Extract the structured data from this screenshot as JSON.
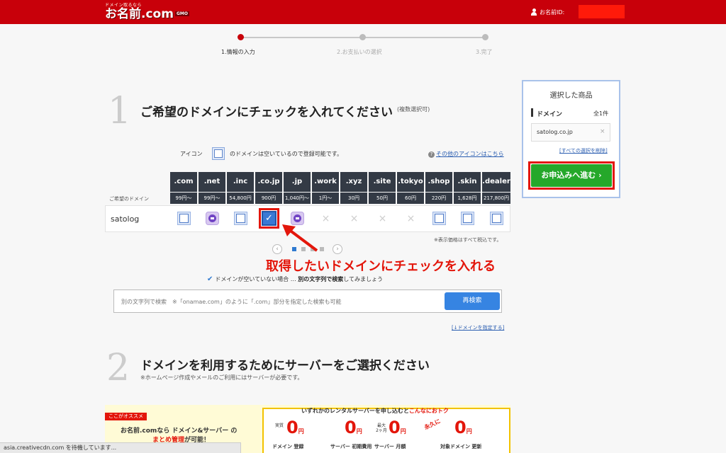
{
  "header": {
    "logo_top": "ドメイン取るなら",
    "logo_main": "お名前.com",
    "logo_badge": "GMO",
    "user_label": "お名前ID:"
  },
  "steps": [
    {
      "label": "1.情報の入力",
      "active": true
    },
    {
      "label": "2.お支払いの選択",
      "active": false
    },
    {
      "label": "3.完了",
      "active": false
    }
  ],
  "section1": {
    "number": "1",
    "title": "ご希望のドメインにチェックを入れてください",
    "note": "(複数選択可)"
  },
  "legend": {
    "prefix": "アイコン",
    "suffix": "のドメインは空いているので登録可能です。",
    "other_icons_link": "その他のアイコンはこちら",
    "help_icon": "?"
  },
  "table": {
    "row_label": "ご希望のドメイン",
    "domain": "satolog",
    "tlds": [
      ".com",
      ".net",
      ".inc",
      ".co.jp",
      ".jp",
      ".work",
      ".xyz",
      ".site",
      ".tokyo",
      ".shop",
      ".skin",
      ".dealer"
    ],
    "prices": [
      "99円〜",
      "99円〜",
      "54,800円",
      "900円",
      "1,040円〜",
      "1円〜",
      "30円",
      "50円",
      "60円",
      "220円",
      "1,628円",
      "217,800円"
    ],
    "status": [
      "available",
      "premium",
      "available",
      "checked",
      "premium",
      "taken",
      "taken",
      "taken",
      "taken",
      "available",
      "available",
      "available"
    ],
    "tax_note": "※表示価格はすべて税込です。",
    "check_mark": "✓",
    "cross_mark": "×"
  },
  "pager": {
    "prev": "‹",
    "next": "›"
  },
  "annotation": "取得したいドメインにチェックを入れる",
  "tip": {
    "check": "✔",
    "part1": "ドメインが空いていない場合 … ",
    "bold": "別の文字列で検索",
    "part2": "してみましょう"
  },
  "search": {
    "placeholder": "別の文字列で検索　※「onamae.com」のように「.com」部分を指定した検索も可能",
    "button": "再検索",
    "specify_link": "[↓ドメインを指定する]"
  },
  "section2": {
    "number": "2",
    "title": "ドメインを利用するためにサーバーをご選択ください",
    "note": "※ホームページ作成やメールのご利用にはサーバーが必要です。"
  },
  "promo": {
    "tag": "ここがオススメ",
    "left_line1": "お名前.comなら ドメイン&サーバー の",
    "left_line2_red": "まとめ管理",
    "left_line2_rest": "が可能！",
    "head_text": "いずれかのレンタルサーバーを申し込むと",
    "head_red": "こんなにおトク",
    "items": [
      {
        "small": "実質",
        "value": "0",
        "unit": "円",
        "caption": "ドメイン 登録"
      },
      {
        "small": "",
        "value": "0",
        "unit": "円",
        "caption": "サーバー 初期費用"
      },
      {
        "small": "最大 2ヶ月",
        "value": "0",
        "unit": "円",
        "caption": "サーバー 月額"
      },
      {
        "small": "",
        "value": "0",
        "unit": "円",
        "caption": "対象ドメイン 更新"
      }
    ],
    "forever": "永久に"
  },
  "statusbar": "asia.creativecdn.com を待機しています...",
  "cart": {
    "title": "選択した商品",
    "label": "ドメイン",
    "count": "全1件",
    "item": "satolog.co.jp",
    "remove": "×",
    "clear_link": "[すべての選択を削除]",
    "button": "お申込みへ進む ›"
  }
}
